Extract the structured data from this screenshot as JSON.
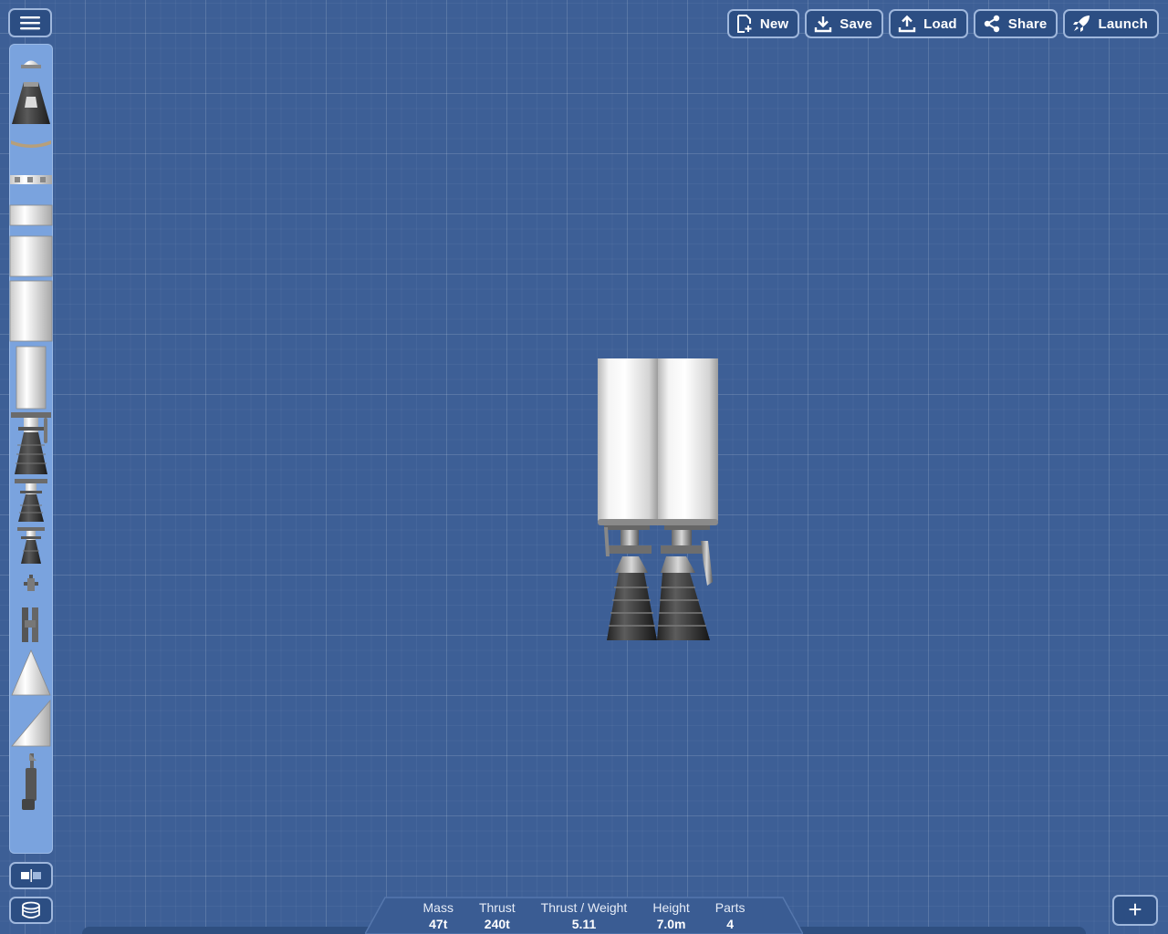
{
  "menu": {
    "icon": "hamburger-icon"
  },
  "toolbar": {
    "buttons": [
      {
        "label": "New",
        "icon": "new-document-icon"
      },
      {
        "label": "Save",
        "icon": "download-icon"
      },
      {
        "label": "Load",
        "icon": "upload-icon"
      },
      {
        "label": "Share",
        "icon": "share-icon"
      },
      {
        "label": "Launch",
        "icon": "rocket-icon"
      }
    ]
  },
  "palette": {
    "parts": [
      "docking-port-icon",
      "command-pod-icon",
      "heat-shield-icon",
      "detacher-icon",
      "small-fuel-tank-icon",
      "medium-fuel-tank-icon",
      "large-fuel-tank-icon",
      "narrow-fuel-tank-icon",
      "large-engine-icon",
      "medium-engine-icon",
      "small-engine-icon",
      "rcs-thruster-icon",
      "side-separator-icon",
      "nose-cone-icon",
      "side-cone-icon",
      "landing-leg-icon"
    ]
  },
  "left_tools": {
    "symmetry_icon": "symmetry-toggle-icon",
    "stage_icon": "stage-icon"
  },
  "stats": [
    {
      "label": "Mass",
      "value": "47t"
    },
    {
      "label": "Thrust",
      "value": "240t"
    },
    {
      "label": "Thrust / Weight",
      "value": "5.11"
    },
    {
      "label": "Height",
      "value": "7.0m"
    },
    {
      "label": "Parts",
      "value": "4"
    }
  ],
  "add_button": {
    "label": "+"
  }
}
